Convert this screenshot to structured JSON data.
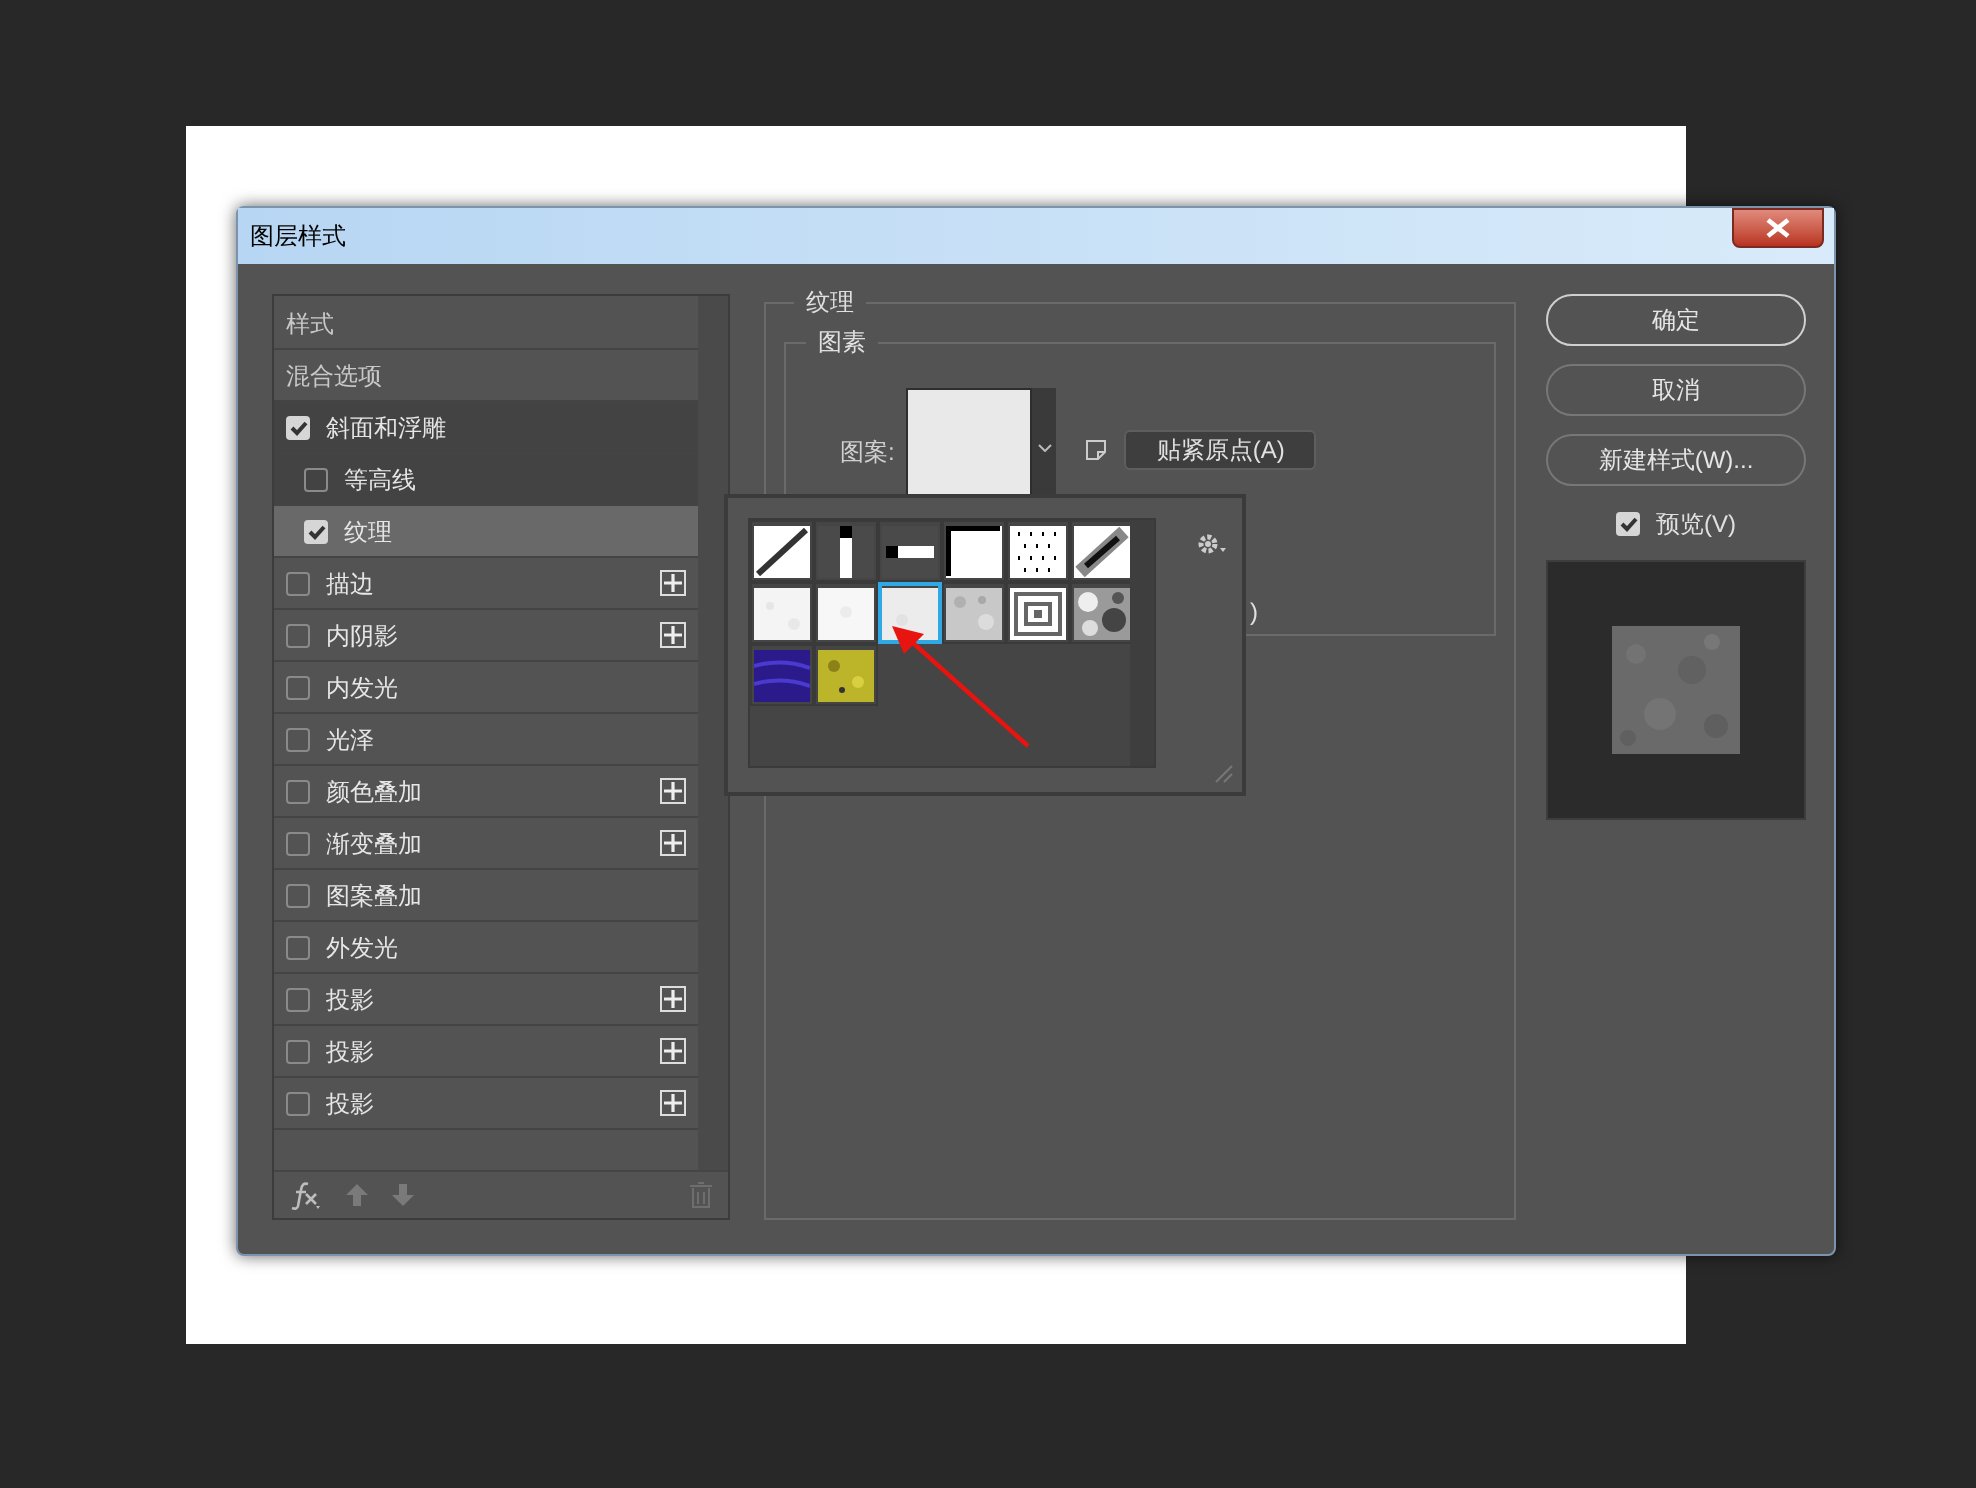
{
  "window": {
    "title": "图层样式"
  },
  "styles_list": {
    "items": [
      {
        "kind": "header",
        "label": "样式",
        "selected": false
      },
      {
        "kind": "header",
        "label": "混合选项",
        "selected": false
      },
      {
        "kind": "check",
        "label": "斜面和浮雕",
        "checked": true,
        "selected": false,
        "add_button": false,
        "expanded": true,
        "children": [
          {
            "kind": "check",
            "label": "等高线",
            "checked": false,
            "selected": false,
            "add_button": false
          },
          {
            "kind": "check",
            "label": "纹理",
            "checked": true,
            "selected": true,
            "add_button": false
          }
        ]
      },
      {
        "kind": "check",
        "label": "描边",
        "checked": false,
        "selected": false,
        "add_button": true
      },
      {
        "kind": "check",
        "label": "内阴影",
        "checked": false,
        "selected": false,
        "add_button": true
      },
      {
        "kind": "check",
        "label": "内发光",
        "checked": false,
        "selected": false,
        "add_button": false
      },
      {
        "kind": "check",
        "label": "光泽",
        "checked": false,
        "selected": false,
        "add_button": false
      },
      {
        "kind": "check",
        "label": "颜色叠加",
        "checked": false,
        "selected": false,
        "add_button": true
      },
      {
        "kind": "check",
        "label": "渐变叠加",
        "checked": false,
        "selected": false,
        "add_button": true
      },
      {
        "kind": "check",
        "label": "图案叠加",
        "checked": false,
        "selected": false,
        "add_button": false
      },
      {
        "kind": "check",
        "label": "外发光",
        "checked": false,
        "selected": false,
        "add_button": false
      },
      {
        "kind": "check",
        "label": "投影",
        "checked": false,
        "selected": false,
        "add_button": true
      },
      {
        "kind": "check",
        "label": "投影",
        "checked": false,
        "selected": false,
        "add_button": true
      },
      {
        "kind": "check",
        "label": "投影",
        "checked": false,
        "selected": false,
        "add_button": true
      }
    ]
  },
  "texture_panel": {
    "title": "纹理",
    "section": {
      "title": "图素",
      "pattern_label": "图案:",
      "snap_button": "贴紧原点(A)",
      "covered_text": ")"
    }
  },
  "pattern_picker": {
    "swatches": [
      {
        "selected": false
      },
      {
        "selected": false
      },
      {
        "selected": false
      },
      {
        "selected": false
      },
      {
        "selected": false
      },
      {
        "selected": false
      },
      {
        "selected": false
      },
      {
        "selected": false
      },
      {
        "selected": true
      },
      {
        "selected": false
      },
      {
        "selected": false
      },
      {
        "selected": false
      },
      {
        "selected": false
      },
      {
        "selected": false
      }
    ]
  },
  "buttons": [
    {
      "label": "确定",
      "default": true
    },
    {
      "label": "取消",
      "default": false
    },
    {
      "label": "新建样式(W)...",
      "default": false
    }
  ],
  "preview": {
    "label": "预览(V)",
    "checked": true
  }
}
